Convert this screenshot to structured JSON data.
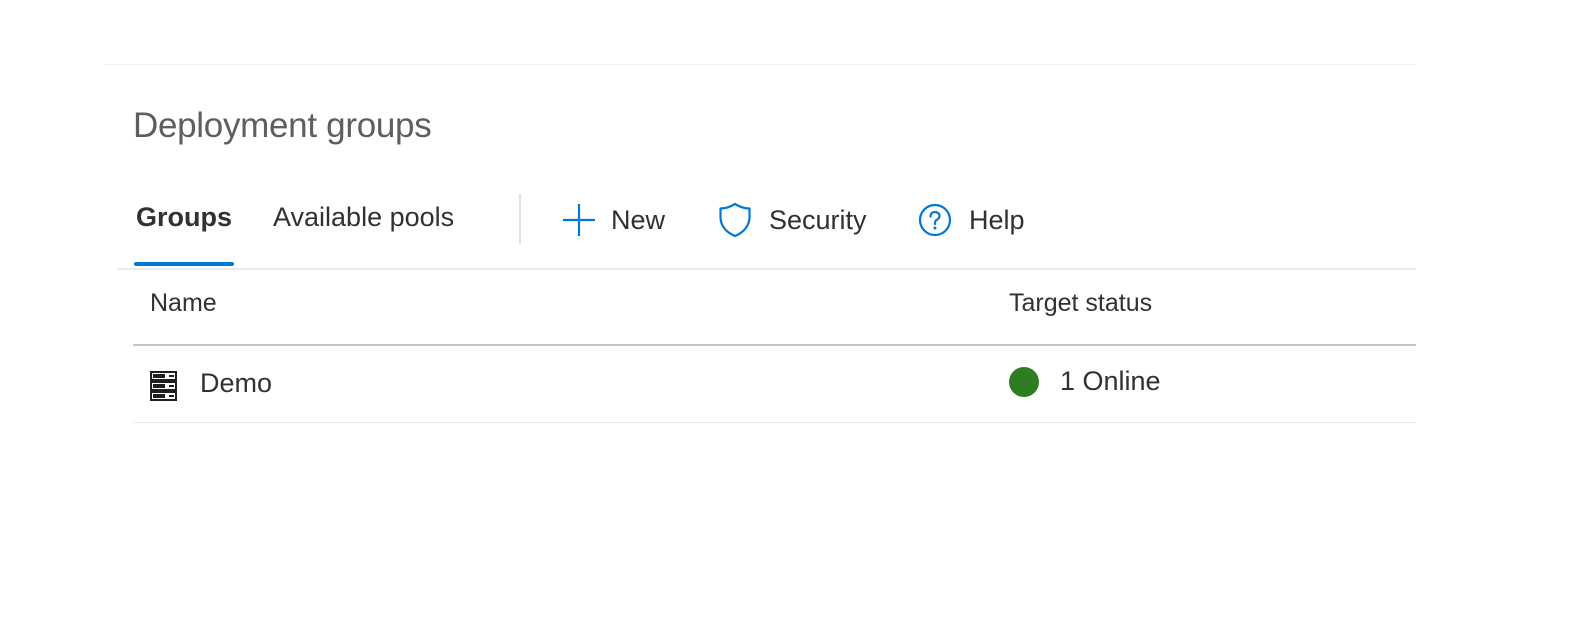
{
  "page": {
    "title": "Deployment groups"
  },
  "tabs": [
    {
      "label": "Groups",
      "selected": true
    },
    {
      "label": "Available pools",
      "selected": false
    }
  ],
  "commands": {
    "new": {
      "label": "New",
      "icon": "plus-icon"
    },
    "security": {
      "label": "Security",
      "icon": "shield-icon"
    },
    "help": {
      "label": "Help",
      "icon": "help-circle-icon"
    }
  },
  "table": {
    "columns": {
      "name": "Name",
      "status": "Target status"
    },
    "rows": [
      {
        "name": "Demo",
        "icon": "server-icon",
        "status": "1 Online",
        "status_color": "#2e7d22"
      }
    ]
  },
  "colors": {
    "accent": "#0078d4",
    "online": "#2e7d22",
    "icon_blue": "#0078d4"
  }
}
